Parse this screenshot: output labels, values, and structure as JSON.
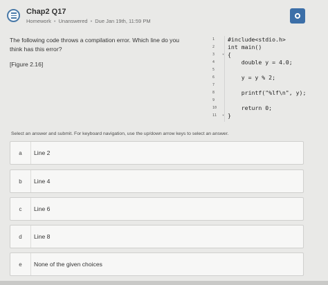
{
  "header": {
    "title": "Chap2 Q17",
    "meta": [
      "Homework",
      "Unanswered",
      "Due Jan 19th, 11:59 PM"
    ],
    "icon": "question-list-icon",
    "action_icon": "circle-icon",
    "accent_color": "#3c6fa8"
  },
  "question": {
    "prompt": "The following code throws a compilation error. Which line do you think has this error?",
    "figure_ref": "[Figure 2.16]"
  },
  "code": {
    "lines": [
      {
        "num": "1",
        "fold": "",
        "text": "#include<stdio.h>"
      },
      {
        "num": "2",
        "fold": "",
        "text": "int main()"
      },
      {
        "num": "3",
        "fold": "▾",
        "text": "{"
      },
      {
        "num": "4",
        "fold": "",
        "text": "    double y = 4.0;"
      },
      {
        "num": "5",
        "fold": "",
        "text": ""
      },
      {
        "num": "6",
        "fold": "",
        "text": "    y = y % 2;"
      },
      {
        "num": "7",
        "fold": "",
        "text": ""
      },
      {
        "num": "8",
        "fold": "",
        "text": "    printf(\"%lf\\n\", y);"
      },
      {
        "num": "9",
        "fold": "",
        "text": ""
      },
      {
        "num": "10",
        "fold": "",
        "text": "    return 0;"
      },
      {
        "num": "11",
        "fold": "▾",
        "text": "}"
      }
    ]
  },
  "instruction": "Select an answer and submit. For keyboard navigation, use the up/down arrow keys to select an answer.",
  "options": [
    {
      "letter": "a",
      "text": "Line 2"
    },
    {
      "letter": "b",
      "text": "Line 4"
    },
    {
      "letter": "c",
      "text": "Line 6"
    },
    {
      "letter": "d",
      "text": "Line 8"
    },
    {
      "letter": "e",
      "text": "None of the given choices"
    }
  ]
}
